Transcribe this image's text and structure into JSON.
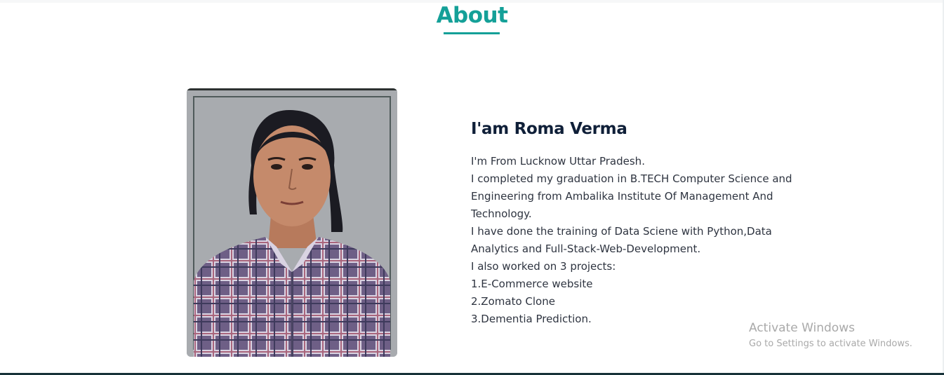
{
  "about": {
    "section_title": "About",
    "heading": "I'am Roma Verma",
    "bio_lines": [
      "I'm From Lucknow Uttar Pradesh.",
      "I completed my graduation in B.TECH Computer Science and",
      "Engineering from Ambalika Institute Of Management And",
      "Technology.",
      "I have done the training of Data Sciene with Python,Data",
      "Analytics and Full-Stack-Web-Development.",
      "I also worked on 3 projects:",
      "1.E-Commerce website",
      "2.Zomato Clone",
      "3.Dementia Prediction."
    ]
  },
  "watermark": {
    "title": "Activate Windows",
    "subtitle": "Go to Settings to activate Windows."
  },
  "colors": {
    "accent": "#14a098",
    "heading": "#0f1f38",
    "body_text": "#2e3440",
    "watermark": "#a9a9a9",
    "footer_bar": "#173238"
  }
}
